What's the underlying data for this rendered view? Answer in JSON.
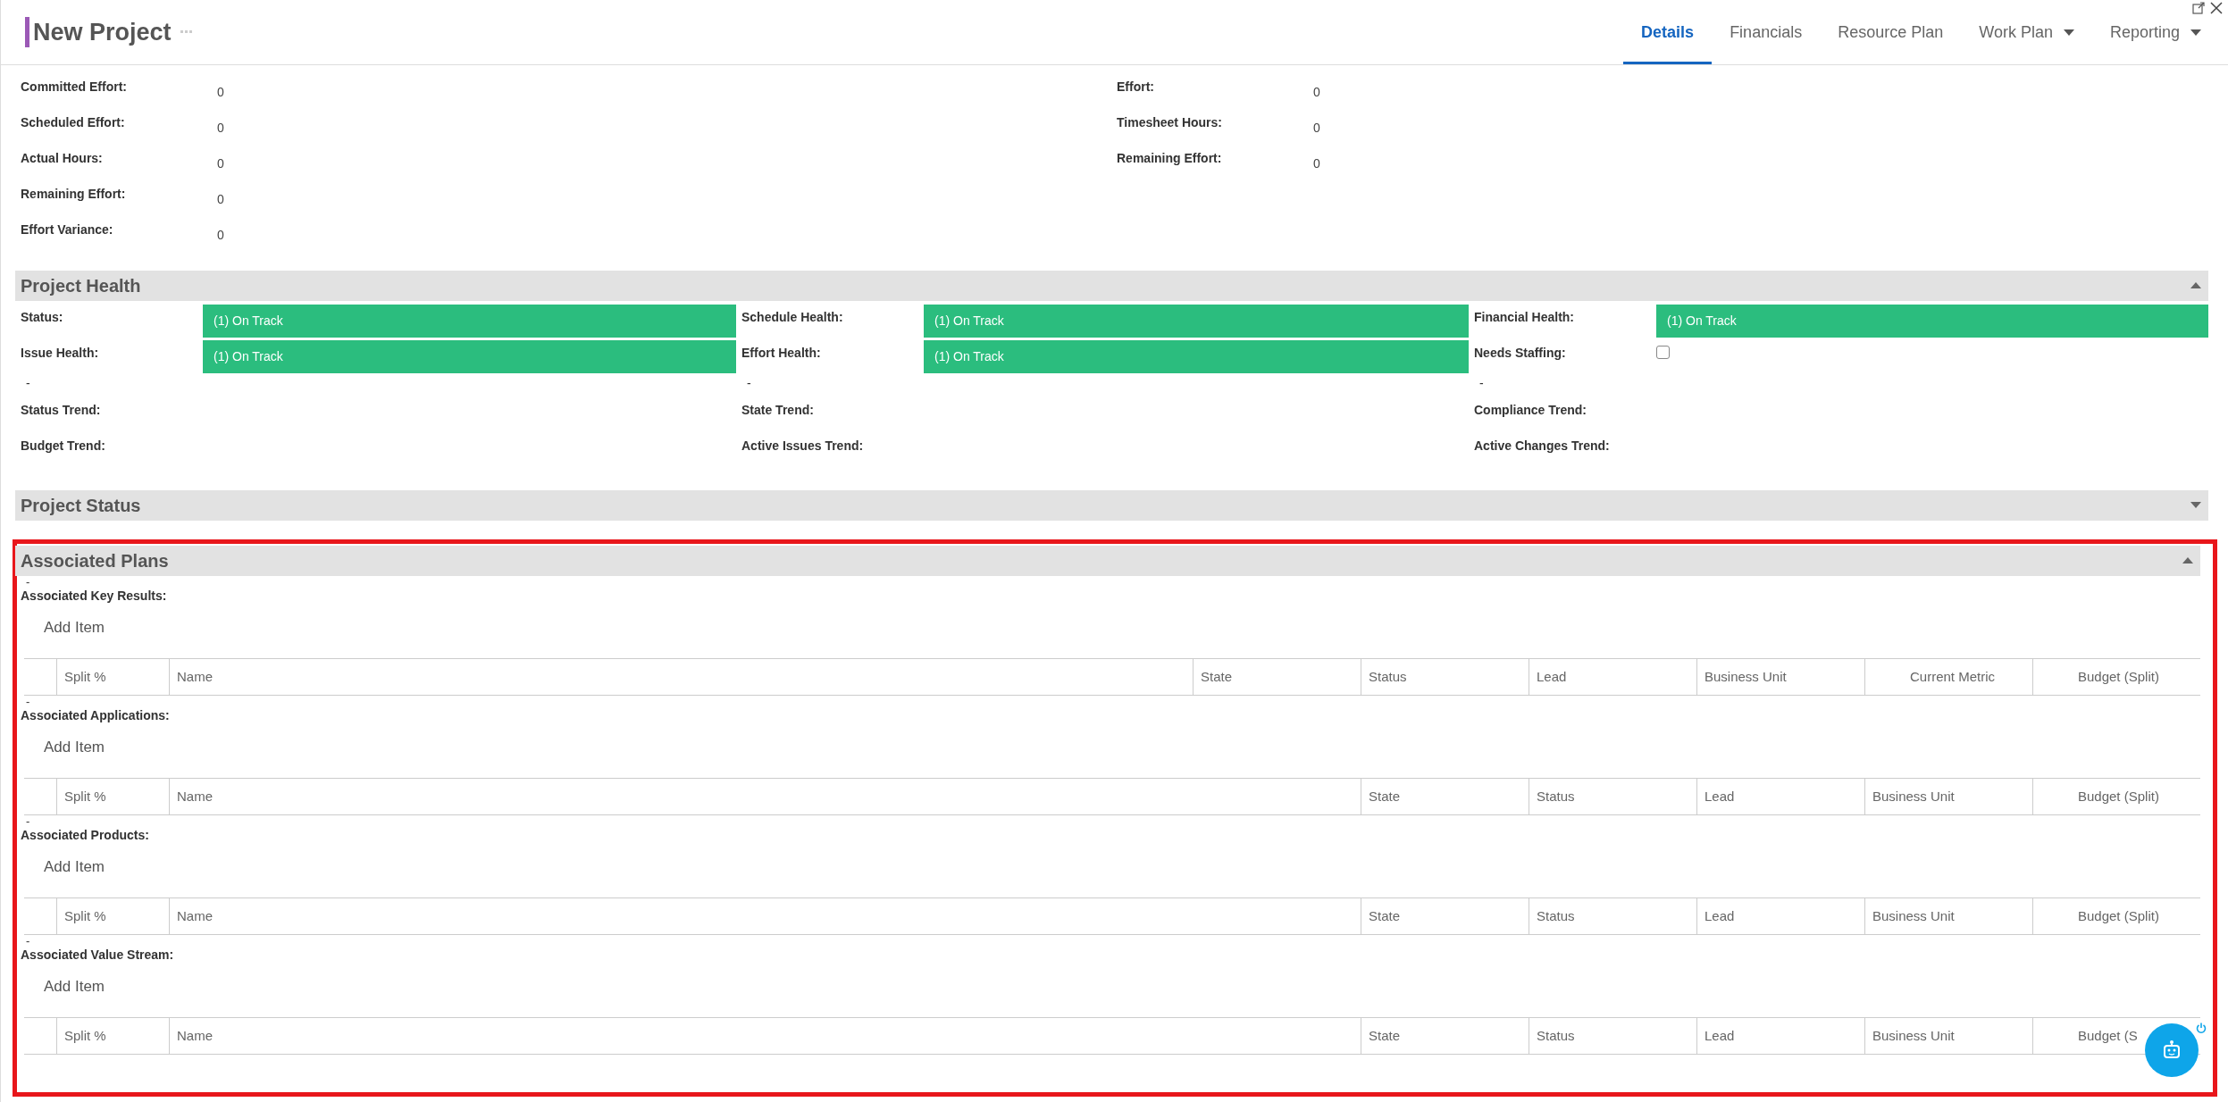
{
  "header": {
    "title": "New Project",
    "tabs": [
      {
        "label": "Details",
        "selected": true,
        "menu": false
      },
      {
        "label": "Financials",
        "selected": false,
        "menu": false
      },
      {
        "label": "Resource Plan",
        "selected": false,
        "menu": false
      },
      {
        "label": "Work Plan",
        "selected": false,
        "menu": true
      },
      {
        "label": "Reporting",
        "selected": false,
        "menu": true
      }
    ]
  },
  "effort": {
    "left": [
      {
        "label": "Committed Effort:",
        "value": "0"
      },
      {
        "label": "Scheduled Effort:",
        "value": "0"
      },
      {
        "label": "Actual Hours:",
        "value": "0"
      },
      {
        "label": "Remaining Effort:",
        "value": "0"
      },
      {
        "label": "Effort Variance:",
        "value": "0"
      }
    ],
    "right": [
      {
        "label": "Effort:",
        "value": "0"
      },
      {
        "label": "Timesheet Hours:",
        "value": "0"
      },
      {
        "label": "Remaining Effort:",
        "value": "0"
      }
    ]
  },
  "project_health": {
    "title": "Project Health",
    "expanded": true,
    "rows": [
      [
        {
          "kind": "badge",
          "label": "Status:",
          "value": "(1) On Track",
          "color": "#2bbd7e"
        },
        {
          "kind": "badge",
          "label": "Schedule Health:",
          "value": "(1) On Track",
          "color": "#2bbd7e"
        },
        {
          "kind": "badge",
          "label": "Financial Health:",
          "value": "(1) On Track",
          "color": "#2bbd7e"
        }
      ],
      [
        {
          "kind": "badge",
          "label": "Issue Health:",
          "value": "(1) On Track",
          "color": "#2bbd7e"
        },
        {
          "kind": "badge",
          "label": "Effort Health:",
          "value": "(1) On Track",
          "color": "#2bbd7e"
        },
        {
          "kind": "checkbox",
          "label": "Needs Staffing:",
          "checked": false
        }
      ],
      [
        {
          "kind": "dash",
          "label": "-"
        },
        {
          "kind": "dash",
          "label": "-"
        },
        {
          "kind": "dash",
          "label": "-"
        }
      ],
      [
        {
          "kind": "field",
          "label": "Status Trend:"
        },
        {
          "kind": "field",
          "label": "State Trend:"
        },
        {
          "kind": "field",
          "label": "Compliance Trend:"
        }
      ],
      [
        {
          "kind": "field",
          "label": "Budget Trend:"
        },
        {
          "kind": "field",
          "label": "Active Issues Trend:"
        },
        {
          "kind": "field",
          "label": "Active Changes Trend:"
        }
      ]
    ]
  },
  "project_status": {
    "title": "Project Status",
    "expanded": false
  },
  "associated_plans": {
    "title": "Associated Plans",
    "expanded": true,
    "groups": [
      {
        "dash": "-",
        "label": "Associated Key Results:",
        "add": "Add Item",
        "columns": [
          {
            "label": "Split %"
          },
          {
            "label": "Name"
          },
          {
            "label": "State"
          },
          {
            "label": "Status"
          },
          {
            "label": "Lead"
          },
          {
            "label": "Business Unit"
          },
          {
            "label": "Current Metric"
          },
          {
            "label": "Budget (Split)"
          }
        ]
      },
      {
        "dash": "-",
        "label": "Associated Applications:",
        "add": "Add Item",
        "columns": [
          {
            "label": "Split %"
          },
          {
            "label": "Name"
          },
          {
            "label": "State"
          },
          {
            "label": "Status"
          },
          {
            "label": "Lead"
          },
          {
            "label": "Business Unit"
          },
          {
            "label": "Budget (Split)"
          }
        ]
      },
      {
        "dash": "-",
        "label": "Associated Products:",
        "add": "Add Item",
        "columns": [
          {
            "label": "Split %"
          },
          {
            "label": "Name"
          },
          {
            "label": "State"
          },
          {
            "label": "Status"
          },
          {
            "label": "Lead"
          },
          {
            "label": "Business Unit"
          },
          {
            "label": "Budget (Split)"
          }
        ]
      },
      {
        "dash": "-",
        "label": "Associated Value Stream:",
        "add": "Add Item",
        "columns": [
          {
            "label": "Split %"
          },
          {
            "label": "Name"
          },
          {
            "label": "State"
          },
          {
            "label": "Status"
          },
          {
            "label": "Lead"
          },
          {
            "label": "Business Unit"
          },
          {
            "label": "Budget (S"
          }
        ]
      }
    ]
  }
}
